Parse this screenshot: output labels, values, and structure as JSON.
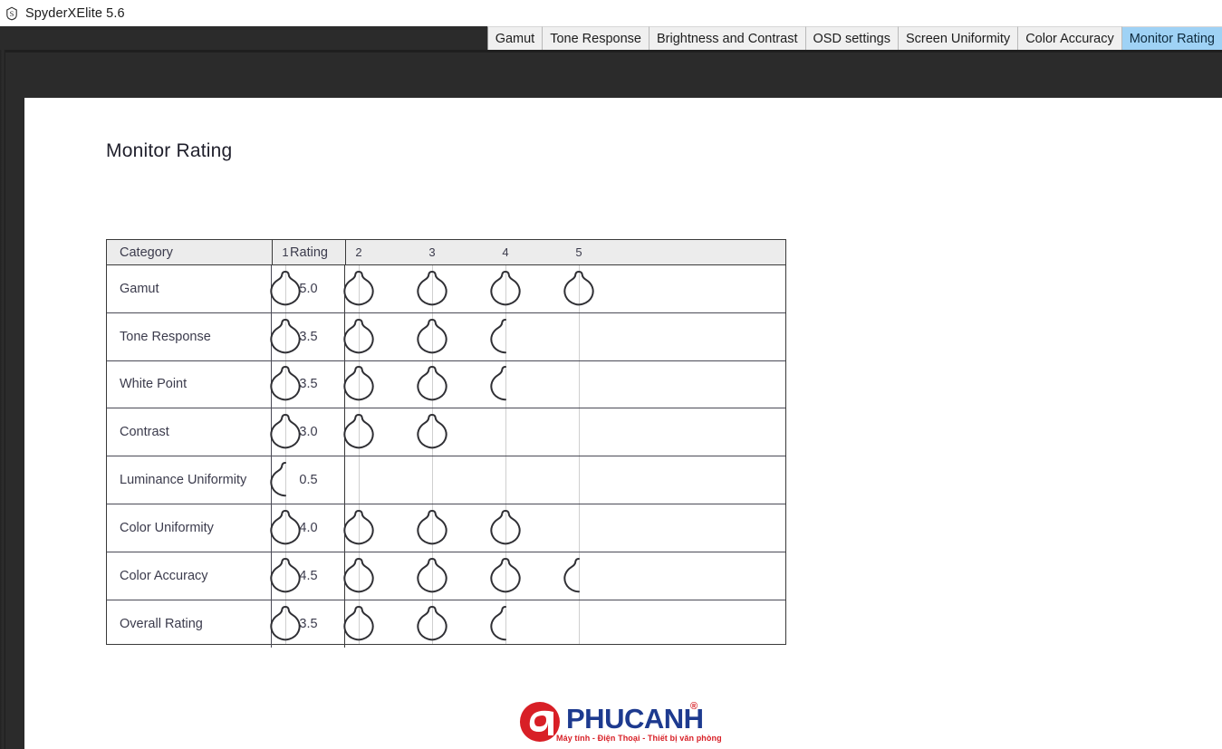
{
  "window": {
    "title": "SpyderXElite 5.6",
    "app_icon": "spyder-s-icon",
    "background_color": "#2b2b2b"
  },
  "tabs": {
    "active_color": "#9fd2f5",
    "items": [
      {
        "label": "Gamut",
        "active": false
      },
      {
        "label": "Tone Response",
        "active": false
      },
      {
        "label": "Brightness and Contrast",
        "active": false
      },
      {
        "label": "OSD settings",
        "active": false
      },
      {
        "label": "Screen Uniformity",
        "active": false
      },
      {
        "label": "Color Accuracy",
        "active": false
      },
      {
        "label": "Monitor Rating",
        "active": true
      }
    ]
  },
  "report": {
    "title": "Monitor Rating"
  },
  "chart_data": {
    "type": "table",
    "title": "Monitor Rating",
    "columns": [
      "Category",
      "Rating"
    ],
    "scale_ticks": [
      "1",
      "2",
      "3",
      "4",
      "5"
    ],
    "xlim": [
      0,
      5
    ],
    "grid": true,
    "max_rating": 5,
    "categories": [
      "Gamut",
      "Tone Response",
      "White Point",
      "Contrast",
      "Luminance Uniformity",
      "Color Uniformity",
      "Color Accuracy",
      "Overall Rating"
    ],
    "values": [
      5.0,
      3.5,
      3.5,
      3.0,
      0.5,
      4.0,
      4.5,
      3.5
    ],
    "value_labels": [
      "5.0",
      "3.5",
      "3.5",
      "3.0",
      "0.5",
      "4.0",
      "4.5",
      "3.5"
    ],
    "rows": [
      {
        "category": "Gamut",
        "rating": "5.0",
        "value": 5.0
      },
      {
        "category": "Tone Response",
        "rating": "3.5",
        "value": 3.5
      },
      {
        "category": "White Point",
        "rating": "3.5",
        "value": 3.5
      },
      {
        "category": "Contrast",
        "rating": "3.0",
        "value": 3.0
      },
      {
        "category": "Luminance Uniformity",
        "rating": "0.5",
        "value": 0.5
      },
      {
        "category": "Color Uniformity",
        "rating": "4.0",
        "value": 4.0
      },
      {
        "category": "Color Accuracy",
        "rating": "4.5",
        "value": 4.5
      },
      {
        "category": "Overall Rating",
        "rating": "3.5",
        "value": 3.5
      }
    ]
  },
  "footer": {
    "brand": "PHUCANH",
    "registered": "®",
    "tagline": "Máy tính - Điện Thoại - Thiết bị văn phòng",
    "mark_color": "#d81f26",
    "text_color": "#1d3a8f"
  }
}
